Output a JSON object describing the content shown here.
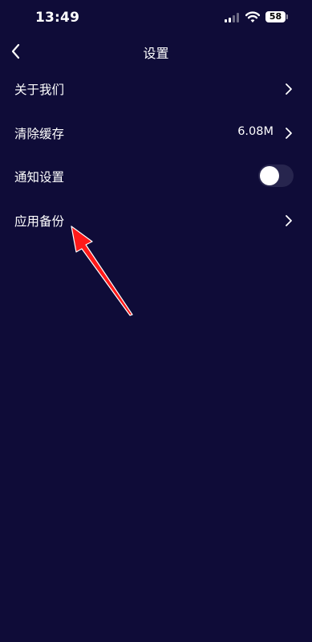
{
  "status_bar": {
    "time": "13:49",
    "battery": "58"
  },
  "nav": {
    "title": "设置",
    "back_icon": "chevron-left-icon"
  },
  "settings": {
    "about": {
      "label": "关于我们"
    },
    "clear_cache": {
      "label": "清除缓存",
      "value": "6.08M"
    },
    "notifications": {
      "label": "通知设置",
      "enabled": false
    },
    "app_backup": {
      "label": "应用备份"
    }
  },
  "annotation": {
    "type": "arrow",
    "color": "#ff1a1a",
    "points_to": "应用备份"
  },
  "colors": {
    "background": "#0f0c38",
    "text": "#ffffff",
    "toggle_off": "#27254e"
  }
}
